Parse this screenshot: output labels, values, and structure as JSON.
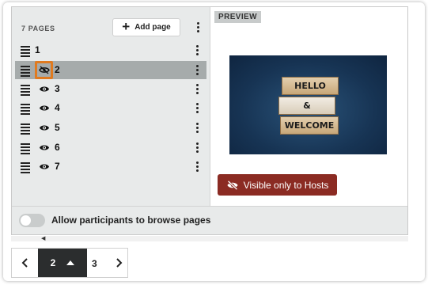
{
  "pages_panel": {
    "count_label": "7 PAGES",
    "add_page_label": "Add page",
    "rows": [
      {
        "label": "1",
        "visibility": "none",
        "selected": false
      },
      {
        "label": "2",
        "visibility": "hosts-only",
        "selected": true
      },
      {
        "label": "3",
        "visibility": "visible",
        "selected": false
      },
      {
        "label": "4",
        "visibility": "visible",
        "selected": false
      },
      {
        "label": "5",
        "visibility": "visible",
        "selected": false
      },
      {
        "label": "6",
        "visibility": "visible",
        "selected": false
      },
      {
        "label": "7",
        "visibility": "visible",
        "selected": false
      }
    ]
  },
  "preview": {
    "tag": "PREVIEW",
    "image_blocks": [
      "HELLO",
      "&",
      "WELCOME"
    ],
    "visibility_badge": "Visible only to Hosts",
    "badge_color": "#8b2b23"
  },
  "settings": {
    "allow_browse_label": "Allow participants to browse pages",
    "allow_browse_enabled": false
  },
  "pager": {
    "current": "2",
    "next": "3"
  },
  "colors": {
    "selected_row": "#a6abab",
    "highlight_outline": "#e07a1f",
    "panel_bg": "#e8eaea"
  }
}
